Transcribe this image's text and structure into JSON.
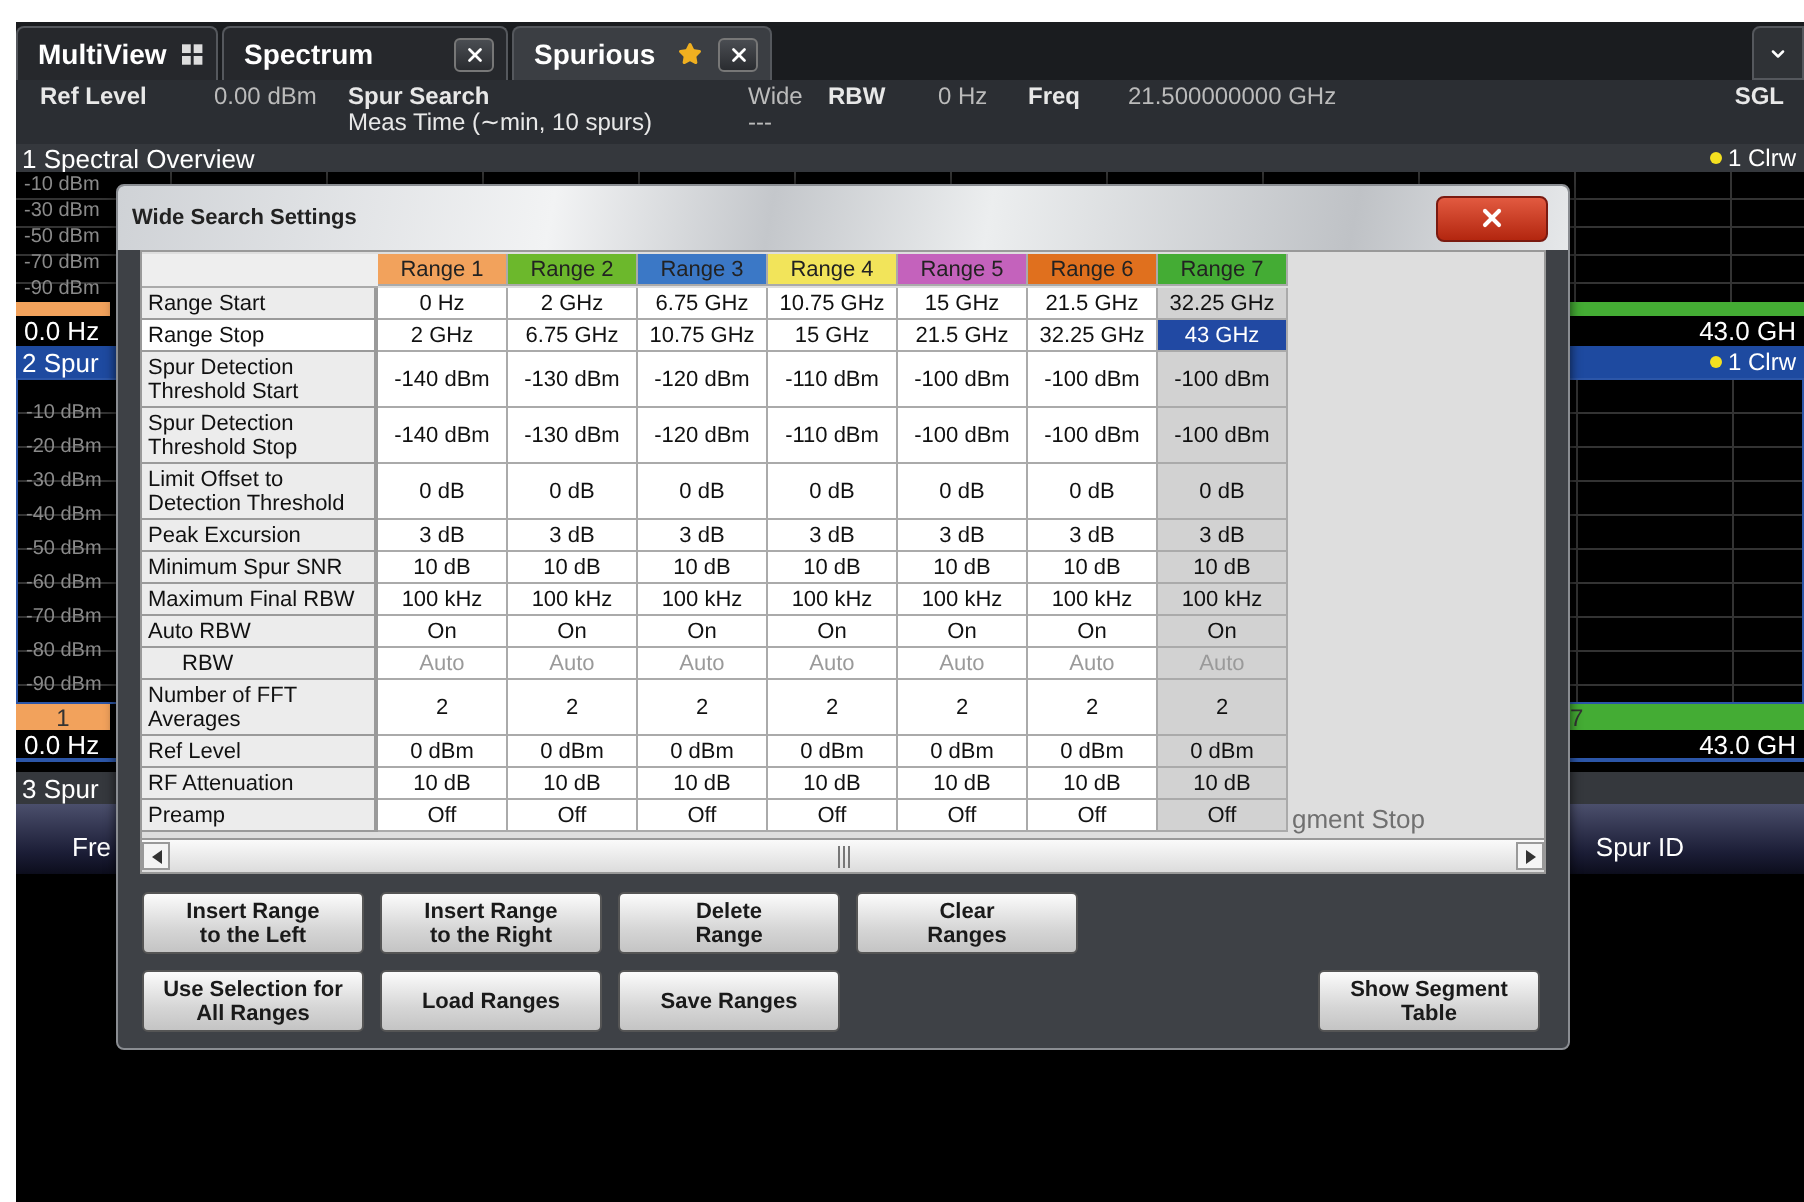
{
  "tabs": [
    {
      "label": "MultiView",
      "kind": "overview",
      "selected": false,
      "closable": false,
      "modified": false
    },
    {
      "label": "Spectrum",
      "kind": "measurement",
      "selected": false,
      "closable": true,
      "modified": false
    },
    {
      "label": "Spurious",
      "kind": "measurement",
      "selected": true,
      "closable": true,
      "modified": true
    }
  ],
  "info_bar": {
    "ref_level_label": "Ref Level",
    "ref_level": "0.00 dBm",
    "mode": "Spur Search",
    "meas_time": "Meas Time (∼min, 10 spurs)",
    "sweep_type": "Wide",
    "sweep_value": "---",
    "rbw_label": "RBW",
    "rbw": "0 Hz",
    "freq_label": "Freq",
    "freq": "21.500000000 GHz",
    "sweep_mode": "SGL"
  },
  "spectral_overview": {
    "title": "1 Spectral Overview",
    "trace": "1 Clrw",
    "y_labels": [
      "-10 dBm",
      "-30 dBm",
      "-50 dBm",
      "-70 dBm",
      "-90 dBm"
    ],
    "start": "0.0 Hz",
    "stop": "43.0 GH"
  },
  "spur_detection": {
    "title": "2 Spur",
    "trace": "1 Clrw",
    "y_labels": [
      "-10 dBm",
      "-20 dBm",
      "-30 dBm",
      "-40 dBm",
      "-50 dBm",
      "-60 dBm",
      "-70 dBm",
      "-80 dBm",
      "-90 dBm"
    ],
    "first_range": "1",
    "last_range": "7",
    "start": "0.0 Hz",
    "stop": "43.0 GH"
  },
  "spur_list": {
    "title": "3 Spur",
    "columns": [
      "Fre",
      "gment Stop",
      "Spur ID"
    ]
  },
  "dialog": {
    "title": "Wide Search Settings",
    "ranges": [
      {
        "label": "Range 1",
        "color": "#f2a25c",
        "selected": false
      },
      {
        "label": "Range 2",
        "color": "#6cb82c",
        "selected": false
      },
      {
        "label": "Range 3",
        "color": "#3b78c6",
        "selected": false
      },
      {
        "label": "Range 4",
        "color": "#f2e45a",
        "selected": false
      },
      {
        "label": "Range 5",
        "color": "#c462bc",
        "selected": false
      },
      {
        "label": "Range 6",
        "color": "#e0701e",
        "selected": false
      },
      {
        "label": "Range 7",
        "color": "#44ac34",
        "selected": true
      }
    ],
    "rows": [
      {
        "label": "Range Start",
        "selected": false,
        "disabled": false,
        "values": [
          "0 Hz",
          "2 GHz",
          "6.75 GHz",
          "10.75 GHz",
          "15 GHz",
          "21.5 GHz",
          "32.25 GHz"
        ]
      },
      {
        "label": "Range Stop",
        "selected": true,
        "disabled": false,
        "values": [
          "2 GHz",
          "6.75 GHz",
          "10.75 GHz",
          "15 GHz",
          "21.5 GHz",
          "32.25 GHz",
          "43 GHz"
        ]
      },
      {
        "label": "Spur Detection Threshold Start",
        "selected": false,
        "disabled": false,
        "values": [
          "-140 dBm",
          "-130 dBm",
          "-120 dBm",
          "-110 dBm",
          "-100 dBm",
          "-100 dBm",
          "-100 dBm"
        ]
      },
      {
        "label": "Spur Detection Threshold Stop",
        "selected": false,
        "disabled": false,
        "values": [
          "-140 dBm",
          "-130 dBm",
          "-120 dBm",
          "-110 dBm",
          "-100 dBm",
          "-100 dBm",
          "-100 dBm"
        ]
      },
      {
        "label": "Limit Offset to Detection Threshold",
        "selected": false,
        "disabled": false,
        "values": [
          "0 dB",
          "0 dB",
          "0 dB",
          "0 dB",
          "0 dB",
          "0 dB",
          "0 dB"
        ]
      },
      {
        "label": "Peak Excursion",
        "selected": false,
        "disabled": false,
        "values": [
          "3 dB",
          "3 dB",
          "3 dB",
          "3 dB",
          "3 dB",
          "3 dB",
          "3 dB"
        ]
      },
      {
        "label": "Minimum Spur SNR",
        "selected": false,
        "disabled": false,
        "values": [
          "10 dB",
          "10 dB",
          "10 dB",
          "10 dB",
          "10 dB",
          "10 dB",
          "10 dB"
        ]
      },
      {
        "label": "Maximum Final RBW",
        "selected": false,
        "disabled": false,
        "values": [
          "100 kHz",
          "100 kHz",
          "100 kHz",
          "100 kHz",
          "100 kHz",
          "100 kHz",
          "100 kHz"
        ]
      },
      {
        "label": "Auto RBW",
        "selected": false,
        "disabled": false,
        "values": [
          "On",
          "On",
          "On",
          "On",
          "On",
          "On",
          "On"
        ]
      },
      {
        "label": "RBW",
        "selected": false,
        "disabled": true,
        "values": [
          "Auto",
          "Auto",
          "Auto",
          "Auto",
          "Auto",
          "Auto",
          "Auto"
        ]
      },
      {
        "label": "Number of FFT Averages",
        "selected": false,
        "disabled": false,
        "values": [
          "2",
          "2",
          "2",
          "2",
          "2",
          "2",
          "2"
        ]
      },
      {
        "label": "Ref Level",
        "selected": false,
        "disabled": false,
        "values": [
          "0 dBm",
          "0 dBm",
          "0 dBm",
          "0 dBm",
          "0 dBm",
          "0 dBm",
          "0 dBm"
        ]
      },
      {
        "label": "RF Attenuation",
        "selected": false,
        "disabled": false,
        "values": [
          "10 dB",
          "10 dB",
          "10 dB",
          "10 dB",
          "10 dB",
          "10 dB",
          "10 dB"
        ]
      },
      {
        "label": "Preamp",
        "selected": false,
        "disabled": false,
        "values": [
          "Off",
          "Off",
          "Off",
          "Off",
          "Off",
          "Off",
          "Off"
        ]
      }
    ],
    "button_rows": [
      [
        "Insert Range\nto the Left",
        "Insert Range\nto the Right",
        "Delete\nRange",
        "Clear\nRanges"
      ],
      [
        "Use Selection for\nAll Ranges",
        "Load Ranges",
        "Save Ranges"
      ]
    ],
    "side_button": "Show Segment\nTable"
  }
}
